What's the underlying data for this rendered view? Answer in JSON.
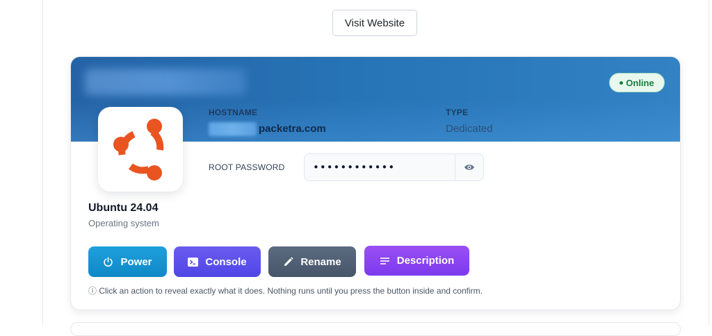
{
  "header": {
    "visit_website_label": "Visit Website"
  },
  "server": {
    "status": "Online",
    "hostname_label": "HOSTNAME",
    "hostname_visible_suffix": "packetra.com",
    "type_label": "TYPE",
    "type_value": "Dedicated",
    "root_password_label": "ROOT PASSWORD",
    "root_password_masked": "••••••••••••",
    "os_name": "Ubuntu 24.04",
    "os_caption": "Operating system"
  },
  "actions": [
    {
      "label": "Power",
      "icon": "power-icon",
      "color": "#0f88c6"
    },
    {
      "label": "Console",
      "icon": "terminal-icon",
      "color": "#4f46e5"
    },
    {
      "label": "Rename",
      "icon": "pencil-icon",
      "color": "#475569"
    },
    {
      "label": "Description",
      "icon": "lines-icon",
      "color": "#7c3aed"
    }
  ],
  "hint_text": "ⓘ Click an action to reveal exactly what it does. Nothing runs until you press the button inside and confirm.",
  "colors": {
    "banner": "#2673b5",
    "online_badge_text": "#15803d",
    "ubuntu_orange": "#e95420"
  }
}
